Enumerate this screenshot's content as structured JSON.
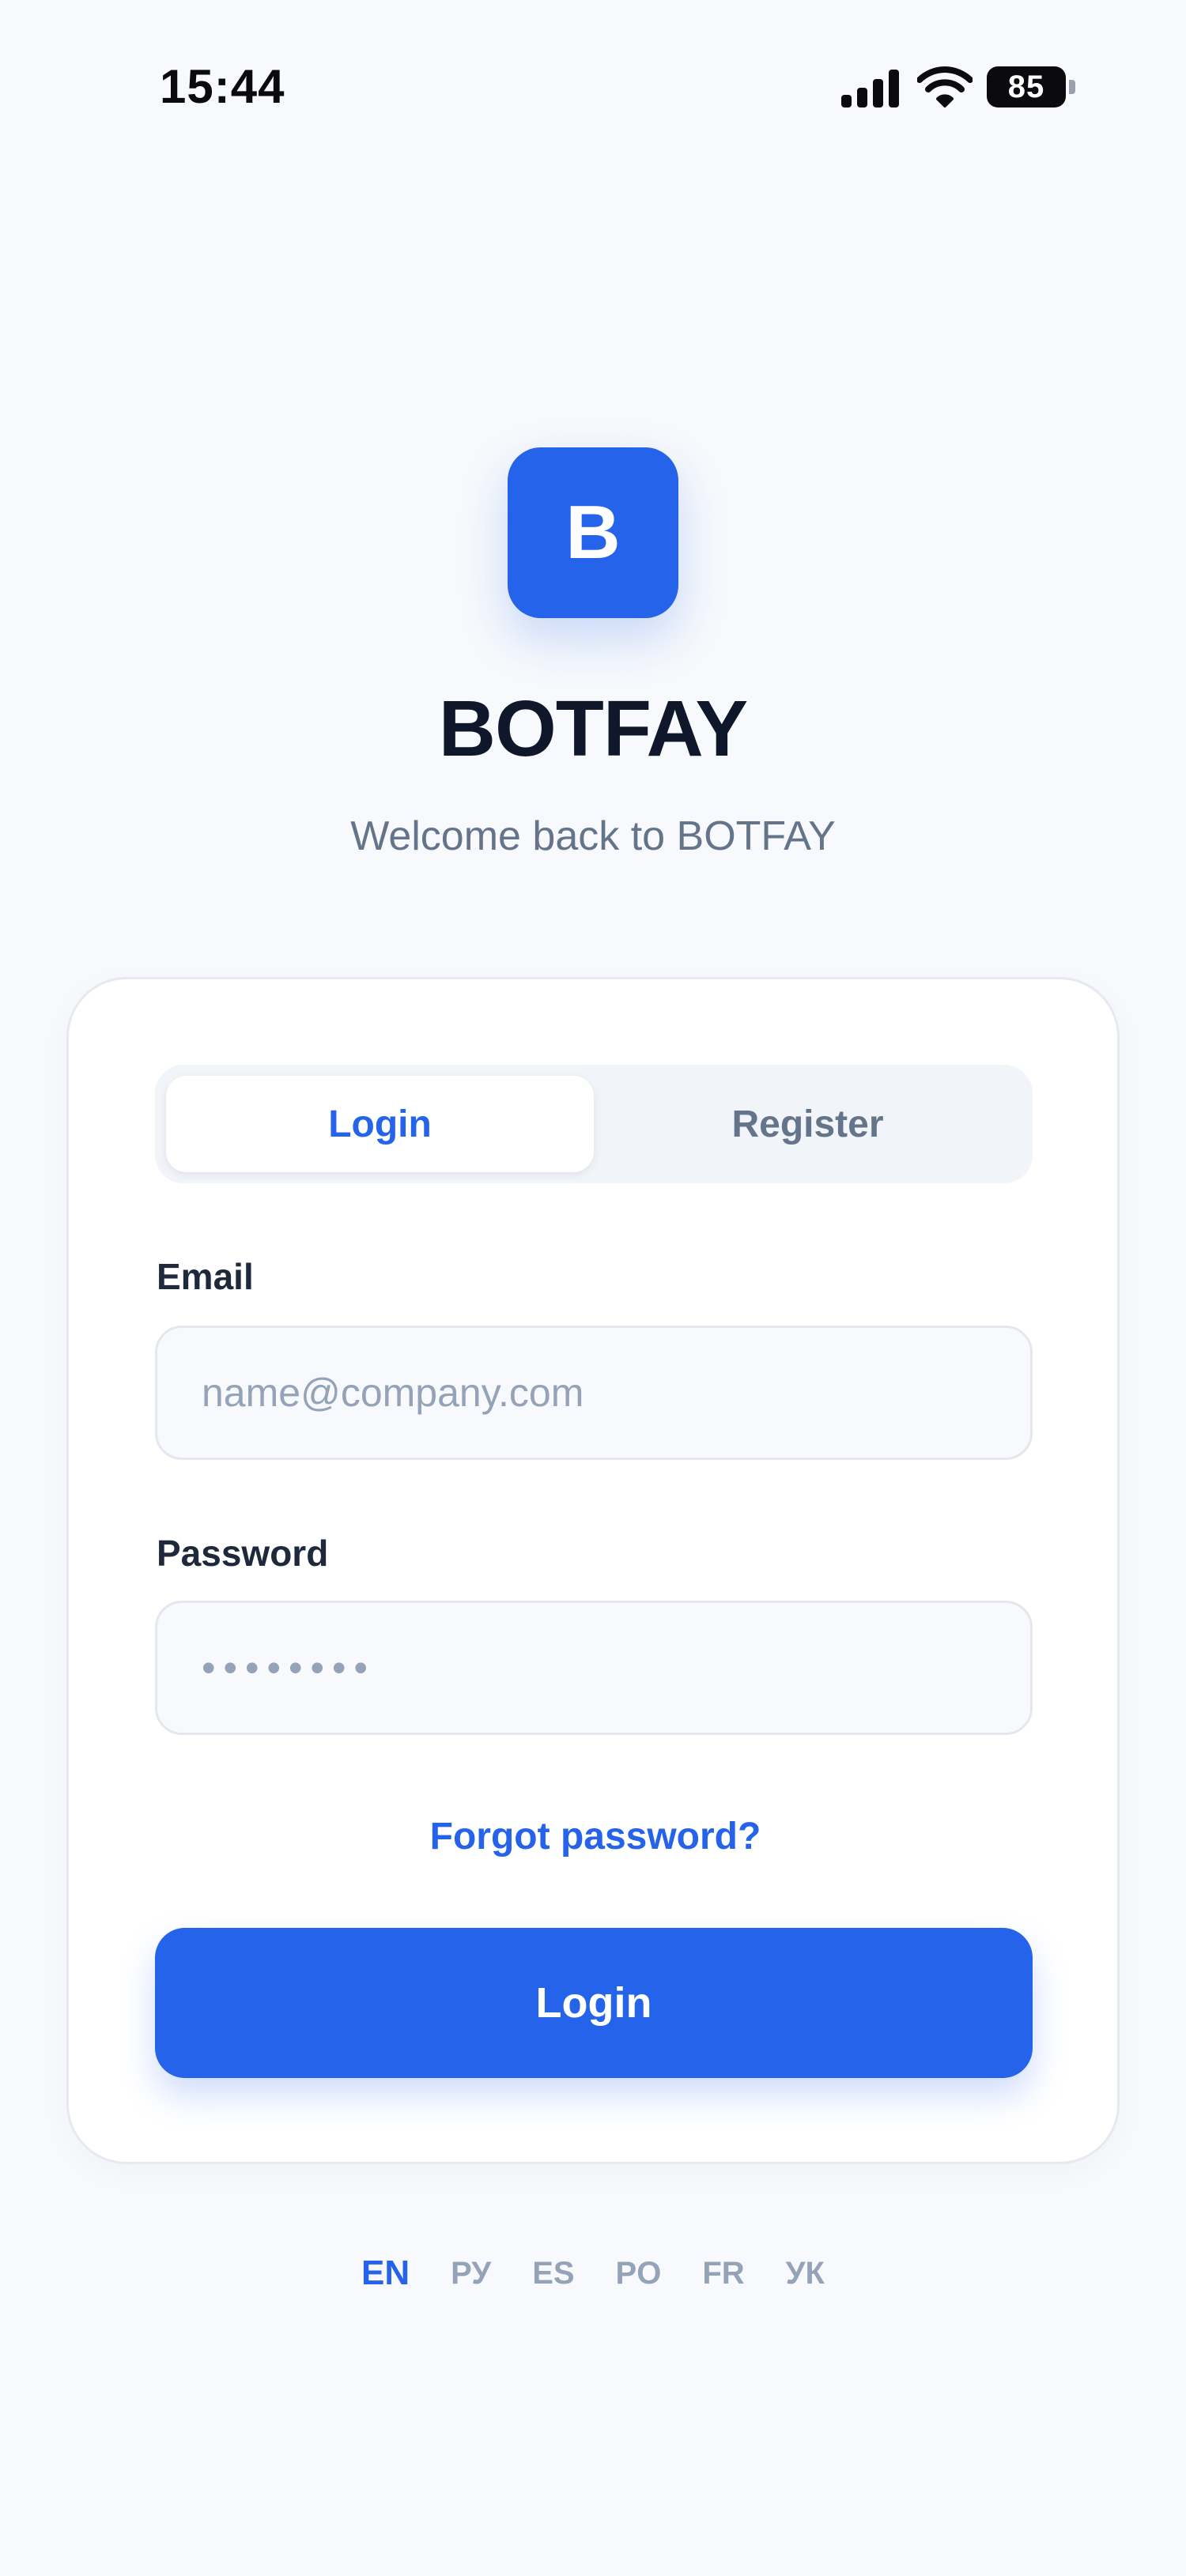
{
  "status_bar": {
    "time": "15:44",
    "signal_icon": "cellular-signal-icon",
    "wifi_icon": "wifi-icon",
    "battery_level": "85"
  },
  "brand": {
    "logo_letter": "B",
    "title": "BOTFAY",
    "subtitle": "Welcome back to BOTFAY",
    "accent_color": "#2563eb"
  },
  "auth": {
    "tabs": [
      {
        "label": "Login",
        "active": true
      },
      {
        "label": "Register",
        "active": false
      }
    ],
    "email": {
      "label": "Email",
      "value": "",
      "placeholder": "name@company.com"
    },
    "password": {
      "label": "Password",
      "value": "",
      "placeholder": "••••••••"
    },
    "forgot_password_label": "Forgot password?",
    "submit_label": "Login"
  },
  "languages": {
    "items": [
      "EN",
      "РУ",
      "ES",
      "PO",
      "FR",
      "УК"
    ],
    "selected": "EN"
  }
}
